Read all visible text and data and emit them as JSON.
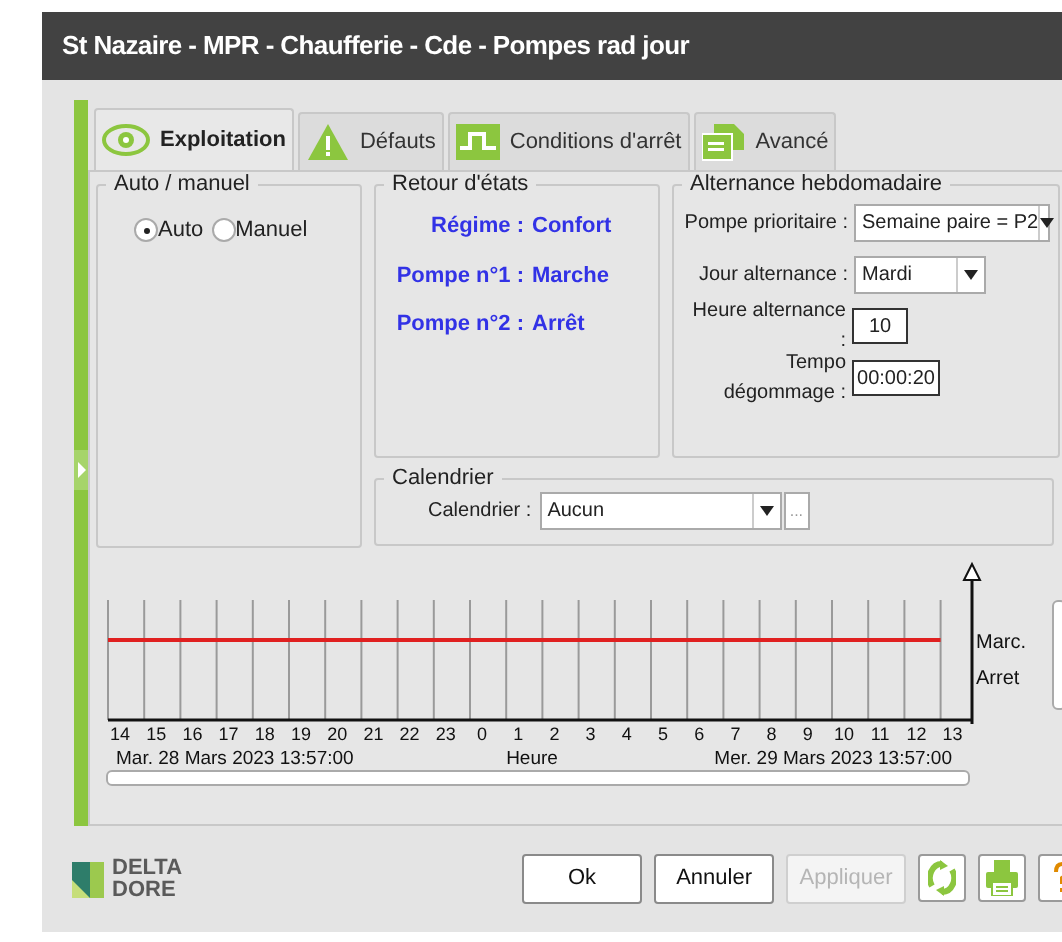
{
  "window": {
    "title": "St Nazaire - MPR - Chaufferie - Cde - Pompes rad jour"
  },
  "tabs": [
    {
      "label": "Exploitation",
      "selected": true,
      "kind": "eye"
    },
    {
      "label": "Défauts",
      "selected": false,
      "kind": "warning"
    },
    {
      "label": "Conditions d'arrêt",
      "selected": false,
      "kind": "signal"
    },
    {
      "label": "Avancé",
      "selected": false,
      "kind": "document"
    }
  ],
  "auto_manuel": {
    "title": "Auto / manuel",
    "options": [
      {
        "label": "Auto",
        "selected": true
      },
      {
        "label": "Manuel",
        "selected": false
      }
    ]
  },
  "retour_etats": {
    "title": "Retour d'états",
    "rows": [
      {
        "label": "Régime :",
        "value": "Confort"
      },
      {
        "label": "Pompe n°1 :",
        "value": "Marche"
      },
      {
        "label": "Pompe n°2 :",
        "value": "Arrêt"
      }
    ]
  },
  "alternance": {
    "title": "Alternance hebdomadaire",
    "fields": [
      {
        "kind": "dropdown",
        "label": "Pompe prioritaire :",
        "value": "Semaine paire = P2"
      },
      {
        "kind": "dropdown",
        "label": "Jour alternance :",
        "value": "Mardi"
      },
      {
        "kind": "input",
        "label": "Heure alternance :",
        "value": "10"
      },
      {
        "kind": "input",
        "label": "Tempo dégommage :",
        "value": "00:00:20"
      }
    ]
  },
  "calendrier": {
    "title": "Calendrier",
    "label": "Calendrier :",
    "value": "Aucun",
    "button": "..."
  },
  "timeline": {
    "hours": [
      "14",
      "15",
      "16",
      "17",
      "18",
      "19",
      "20",
      "21",
      "22",
      "23",
      "0",
      "1",
      "2",
      "3",
      "4",
      "5",
      "6",
      "7",
      "8",
      "9",
      "10",
      "11",
      "12",
      "13"
    ],
    "states": [
      "Marc.",
      "Arret"
    ],
    "start": "Mar. 28 Mars 2023 13:57:00",
    "axis_label": "Heure",
    "end": "Mer. 29 Mars 2023 13:57:00"
  },
  "logo": {
    "lines": [
      "DELTA",
      "DORE"
    ]
  },
  "buttons": [
    {
      "label": "Ok",
      "disabled": false
    },
    {
      "label": "Annuler",
      "disabled": false
    },
    {
      "label": "Appliquer",
      "disabled": true
    }
  ],
  "icon_buttons": [
    {
      "kind": "refresh"
    },
    {
      "kind": "print"
    },
    {
      "kind": "help"
    }
  ]
}
